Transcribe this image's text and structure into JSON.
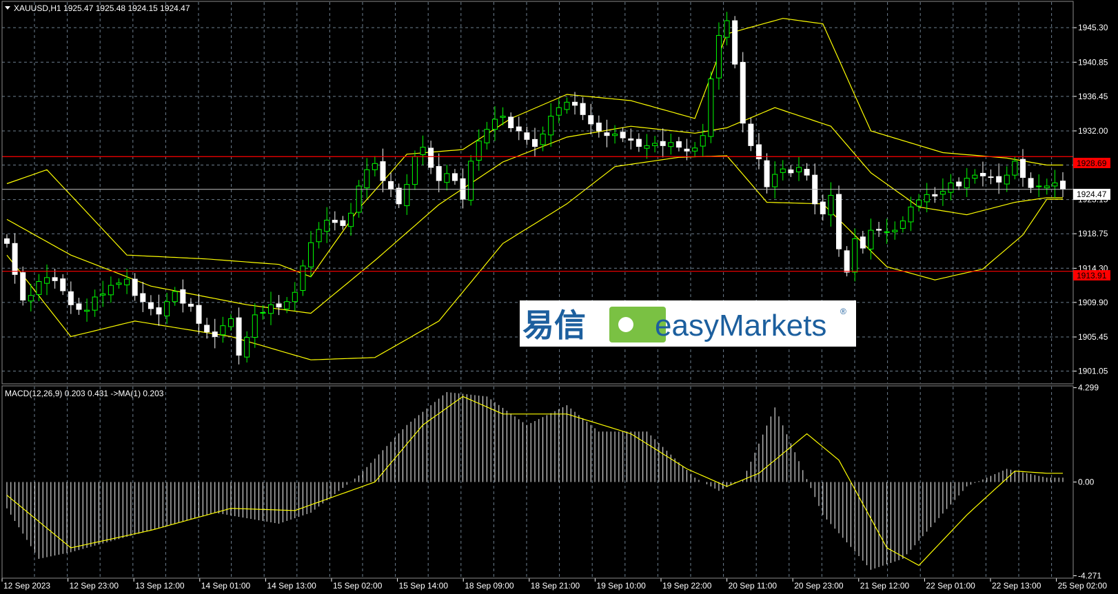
{
  "header": {
    "symbol_line": "XAUUSD,H1  1925.47 1925.48 1924.15 1924.47"
  },
  "macd_header": {
    "line": "MACD(12,26,9) 0.203 0.431  ->MA(1) 0.203"
  },
  "price_axis": {
    "ticks": [
      "1945.30",
      "1940.85",
      "1936.45",
      "1932.00",
      "1927.60",
      "1923.15",
      "1918.75",
      "1914.30",
      "1909.90",
      "1905.45",
      "1901.05"
    ],
    "ymin": 1899.5,
    "ymax": 1948.6
  },
  "macd_axis": {
    "ticks": [
      "4.299",
      "0.00",
      "-4.271"
    ],
    "ymin": -4.35,
    "ymax": 4.35
  },
  "current_price_tag": "1924.47",
  "levels": [
    {
      "value": 1928.69,
      "label": "1928.69",
      "color": "#ff0000"
    },
    {
      "value": 1913.91,
      "label": "1913.91",
      "color": "#ff0000"
    }
  ],
  "time_axis": {
    "ticks": [
      "12 Sep 2023",
      "12 Sep 23:00",
      "13 Sep 12:00",
      "14 Sep 01:00",
      "14 Sep 13:00",
      "15 Sep 02:00",
      "15 Sep 14:00",
      "18 Sep 09:00",
      "18 Sep 21:00",
      "19 Sep 10:00",
      "19 Sep 22:00",
      "20 Sep 11:00",
      "20 Sep 23:00",
      "21 Sep 12:00",
      "22 Sep 01:00",
      "22 Sep 13:00",
      "25 Sep 02:00"
    ]
  },
  "watermark": {
    "cn_text": "易信",
    "brand_text": "easyMarkets",
    "registered": "®"
  },
  "colors": {
    "background": "#000000",
    "grid": "#6e7f8f",
    "bull_candle": "#00ff00",
    "bear_candle": "#ffffff",
    "bollinger": "#ffff00",
    "level_line": "#ff0000",
    "current_price_line": "#c0c0c0",
    "macd_hist": "#ffffff",
    "macd_signal": "#ffff00",
    "axis_text": "#ffffff"
  },
  "chart_data": {
    "type": "candlestick",
    "symbol": "XAUUSD",
    "timeframe": "H1",
    "close_path": [
      1917.5,
      1913.5,
      1910.2,
      1910.8,
      1912.6,
      1913.1,
      1912.7,
      1911.4,
      1909.6,
      1909.0,
      1908.9,
      1910.6,
      1911.0,
      1912.1,
      1912.4,
      1912.9,
      1910.8,
      1910.0,
      1909.1,
      1908.4,
      1910.0,
      1911.3,
      1909.8,
      1909.4,
      1907.2,
      1906.1,
      1905.5,
      1906.9,
      1907.8,
      1903.1,
      1905.4,
      1908.3,
      1908.6,
      1909.6,
      1909.3,
      1910.0,
      1911.2,
      1914.6,
      1917.6,
      1919.3,
      1920.5,
      1920.2,
      1919.8,
      1921.4,
      1924.9,
      1927.0,
      1927.8,
      1925.6,
      1924.5,
      1922.6,
      1925.1,
      1928.7,
      1929.9,
      1927.3,
      1925.6,
      1926.5,
      1925.6,
      1923.2,
      1928.1,
      1930.7,
      1932.2,
      1933.5,
      1933.9,
      1932.4,
      1932.0,
      1930.9,
      1930.0,
      1931.6,
      1933.9,
      1935.0,
      1935.7,
      1935.3,
      1934.1,
      1932.9,
      1932.0,
      1931.4,
      1931.6,
      1931.1,
      1930.8,
      1930.0,
      1930.1,
      1930.4,
      1930.1,
      1930.5,
      1929.9,
      1929.4,
      1929.8,
      1931.4,
      1938.7,
      1944.3,
      1946.2,
      1940.6,
      1933.0,
      1930.1,
      1928.4,
      1924.8,
      1926.4,
      1927.1,
      1926.6,
      1927.3,
      1926.3,
      1922.6,
      1921.3,
      1923.7,
      1916.8,
      1913.8,
      1918.1,
      1916.9,
      1919.2,
      1919.2,
      1919.0,
      1919.2,
      1920.4,
      1922.2,
      1923.1,
      1923.8,
      1923.6,
      1924.2,
      1925.3,
      1924.9,
      1925.9,
      1926.3,
      1926.2,
      1926.0,
      1925.4,
      1926.3,
      1928.1,
      1926.0,
      1924.7,
      1924.9,
      1924.9,
      1925.3,
      1924.5
    ],
    "bollinger": {
      "upper": [
        {
          "t": 0,
          "v": 1925.2
        },
        {
          "t": 5,
          "v": 1927.0
        },
        {
          "t": 15,
          "v": 1916.0
        },
        {
          "t": 25,
          "v": 1915.5
        },
        {
          "t": 34,
          "v": 1914.8
        },
        {
          "t": 38,
          "v": 1913.2
        },
        {
          "t": 44,
          "v": 1922.0
        },
        {
          "t": 50,
          "v": 1929.0
        },
        {
          "t": 57,
          "v": 1929.6
        },
        {
          "t": 63,
          "v": 1933.6
        },
        {
          "t": 70,
          "v": 1936.7
        },
        {
          "t": 78,
          "v": 1935.9
        },
        {
          "t": 86,
          "v": 1933.6
        },
        {
          "t": 90,
          "v": 1944.5
        },
        {
          "t": 97,
          "v": 1946.5
        },
        {
          "t": 102,
          "v": 1945.8
        },
        {
          "t": 108,
          "v": 1932.0
        },
        {
          "t": 117,
          "v": 1929.2
        },
        {
          "t": 125,
          "v": 1928.5
        },
        {
          "t": 130,
          "v": 1927.6
        }
      ],
      "middle": [
        {
          "t": 0,
          "v": 1920.6
        },
        {
          "t": 8,
          "v": 1916.0
        },
        {
          "t": 18,
          "v": 1912.0
        },
        {
          "t": 30,
          "v": 1909.6
        },
        {
          "t": 38,
          "v": 1908.5
        },
        {
          "t": 46,
          "v": 1915.3
        },
        {
          "t": 54,
          "v": 1922.5
        },
        {
          "t": 62,
          "v": 1928.0
        },
        {
          "t": 70,
          "v": 1931.2
        },
        {
          "t": 78,
          "v": 1932.6
        },
        {
          "t": 86,
          "v": 1931.7
        },
        {
          "t": 90,
          "v": 1932.4
        },
        {
          "t": 96,
          "v": 1935.0
        },
        {
          "t": 103,
          "v": 1932.6
        },
        {
          "t": 108,
          "v": 1926.6
        },
        {
          "t": 114,
          "v": 1922.2
        },
        {
          "t": 120,
          "v": 1921.2
        },
        {
          "t": 126,
          "v": 1922.8
        },
        {
          "t": 130,
          "v": 1923.4
        }
      ],
      "lower": [
        {
          "t": 0,
          "v": 1916.0
        },
        {
          "t": 8,
          "v": 1905.5
        },
        {
          "t": 16,
          "v": 1907.5
        },
        {
          "t": 28,
          "v": 1905.5
        },
        {
          "t": 38,
          "v": 1902.5
        },
        {
          "t": 46,
          "v": 1902.8
        },
        {
          "t": 54,
          "v": 1907.5
        },
        {
          "t": 62,
          "v": 1917.5
        },
        {
          "t": 70,
          "v": 1922.6
        },
        {
          "t": 76,
          "v": 1927.4
        },
        {
          "t": 84,
          "v": 1928.6
        },
        {
          "t": 90,
          "v": 1928.8
        },
        {
          "t": 95,
          "v": 1922.8
        },
        {
          "t": 102,
          "v": 1922.6
        },
        {
          "t": 110,
          "v": 1914.5
        },
        {
          "t": 116,
          "v": 1912.8
        },
        {
          "t": 122,
          "v": 1914.2
        },
        {
          "t": 127,
          "v": 1918.6
        },
        {
          "t": 130,
          "v": 1923.2
        }
      ]
    },
    "macd": {
      "histogram_path": [
        {
          "t": 0,
          "v": -1.2
        },
        {
          "t": 4,
          "v": -3.5
        },
        {
          "t": 8,
          "v": -3.2
        },
        {
          "t": 16,
          "v": -2.4
        },
        {
          "t": 26,
          "v": -1.4
        },
        {
          "t": 34,
          "v": -1.9
        },
        {
          "t": 38,
          "v": -1.4
        },
        {
          "t": 44,
          "v": 0.3
        },
        {
          "t": 50,
          "v": 2.6
        },
        {
          "t": 55,
          "v": 4.1
        },
        {
          "t": 60,
          "v": 3.9
        },
        {
          "t": 65,
          "v": 2.6
        },
        {
          "t": 70,
          "v": 3.5
        },
        {
          "t": 74,
          "v": 2.3
        },
        {
          "t": 80,
          "v": 2.3
        },
        {
          "t": 86,
          "v": 0.2
        },
        {
          "t": 89,
          "v": -0.4
        },
        {
          "t": 92,
          "v": 0.1
        },
        {
          "t": 96,
          "v": 3.4
        },
        {
          "t": 102,
          "v": -1.5
        },
        {
          "t": 108,
          "v": -4.0
        },
        {
          "t": 112,
          "v": -3.5
        },
        {
          "t": 120,
          "v": -0.2
        },
        {
          "t": 125,
          "v": 0.6
        },
        {
          "t": 130,
          "v": 0.2
        }
      ],
      "signal_path": [
        {
          "t": 0,
          "v": -0.6
        },
        {
          "t": 8,
          "v": -3.0
        },
        {
          "t": 18,
          "v": -2.2
        },
        {
          "t": 28,
          "v": -1.2
        },
        {
          "t": 36,
          "v": -1.3
        },
        {
          "t": 46,
          "v": 0.0
        },
        {
          "t": 52,
          "v": 2.6
        },
        {
          "t": 57,
          "v": 3.9
        },
        {
          "t": 62,
          "v": 3.1
        },
        {
          "t": 70,
          "v": 3.1
        },
        {
          "t": 78,
          "v": 2.2
        },
        {
          "t": 85,
          "v": 0.6
        },
        {
          "t": 90,
          "v": -0.2
        },
        {
          "t": 94,
          "v": 0.4
        },
        {
          "t": 100,
          "v": 2.2
        },
        {
          "t": 104,
          "v": 1.0
        },
        {
          "t": 110,
          "v": -3.0
        },
        {
          "t": 114,
          "v": -3.8
        },
        {
          "t": 120,
          "v": -1.5
        },
        {
          "t": 126,
          "v": 0.5
        },
        {
          "t": 130,
          "v": 0.4
        }
      ]
    }
  }
}
